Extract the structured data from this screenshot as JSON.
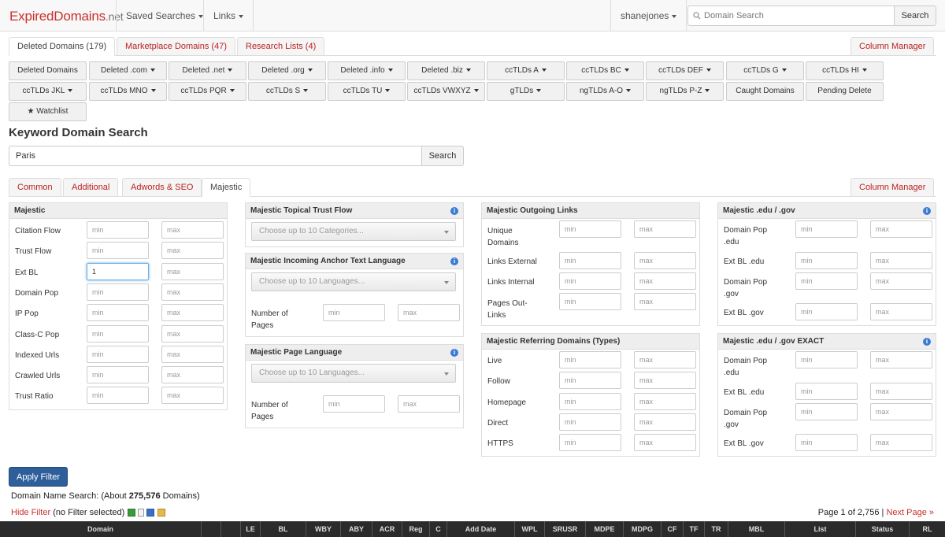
{
  "nav": {
    "brand_main": "ExpiredDomains",
    "brand_tld": ".net",
    "saved_searches": "Saved Searches",
    "links": "Links",
    "user": "shanejones",
    "search_placeholder": "Domain Search",
    "search_button": "Search"
  },
  "main_tabs": [
    {
      "label": "Deleted Domains (179)"
    },
    {
      "label": "Marketplace Domains (47)"
    },
    {
      "label": "Research Lists (4)"
    }
  ],
  "column_manager": "Column Manager",
  "filter_buttons_row1": [
    "Deleted Domains",
    "Deleted .com",
    "Deleted .net",
    "Deleted .org",
    "Deleted .info",
    "Deleted .biz",
    "ccTLDs A",
    "ccTLDs BC",
    "ccTLDs DEF",
    "ccTLDs G",
    "ccTLDs HI"
  ],
  "filter_buttons_row2": [
    "ccTLDs JKL",
    "ccTLDs MNO",
    "ccTLDs PQR",
    "ccTLDs S",
    "ccTLDs TU",
    "ccTLDs VWXYZ",
    "gTLDs",
    "ngTLDs A-O",
    "ngTLDs P-Z",
    "Caught Domains",
    "Pending Delete"
  ],
  "watchlist": "Watchlist",
  "keyword": {
    "title": "Keyword Domain Search",
    "value": "Paris",
    "button": "Search"
  },
  "filter_tabs": [
    {
      "label": "Common"
    },
    {
      "label": "Additional"
    },
    {
      "label": "Adwords & SEO"
    },
    {
      "label": "Majestic"
    }
  ],
  "placeholders": {
    "min": "min",
    "max": "max"
  },
  "majestic": {
    "title": "Majestic",
    "rows": [
      "Citation Flow",
      "Trust Flow",
      "Ext BL",
      "Domain Pop",
      "IP Pop",
      "Class-C Pop",
      "Indexed Urls",
      "Crawled Urls",
      "Trust Ratio"
    ],
    "ext_bl_min_value": "1"
  },
  "topical": {
    "title": "Majestic Topical Trust Flow",
    "placeholder": "Choose up to 10 Categories..."
  },
  "anchor": {
    "title": "Majestic Incoming Anchor Text Language",
    "placeholder": "Choose up to 10 Languages...",
    "pages_label_1": "Number of",
    "pages_label_2": "Pages"
  },
  "pagelang": {
    "title": "Majestic Page Language",
    "placeholder": "Choose up to 10 Languages...",
    "pages_label_1": "Number of",
    "pages_label_2": "Pages"
  },
  "outgoing": {
    "title": "Majestic Outgoing Links",
    "rows": [
      [
        "Unique",
        "Domains"
      ],
      [
        "Links External"
      ],
      [
        "Links Internal"
      ],
      [
        "Pages Out-",
        "Links"
      ]
    ]
  },
  "referring": {
    "title": "Majestic Referring Domains (Types)",
    "rows": [
      "Live",
      "Follow",
      "Homepage",
      "Direct",
      "HTTPS"
    ]
  },
  "edugov": {
    "title": "Majestic .edu / .gov",
    "rows": [
      [
        "Domain Pop",
        ".edu"
      ],
      [
        "Ext BL .edu"
      ],
      [
        "Domain Pop",
        ".gov"
      ],
      [
        "Ext BL .gov"
      ]
    ]
  },
  "edugov_exact": {
    "title": "Majestic .edu / .gov EXACT",
    "rows": [
      [
        "Domain Pop",
        ".edu"
      ],
      [
        "Ext BL .edu"
      ],
      [
        "Domain Pop",
        ".gov"
      ],
      [
        "Ext BL .gov"
      ]
    ]
  },
  "apply_filter": "Apply Filter",
  "results": {
    "prefix": "Domain Name Search: (About",
    "count": "275,576",
    "suffix": "Domains)",
    "hide_filter": "Hide Filter",
    "no_filter": "(no Filter selected)",
    "page_info": "Page 1 of 2,756 |",
    "next_page": "Next Page »"
  },
  "table_headers": [
    "Domain",
    "LE",
    "BL",
    "WBY",
    "ABY",
    "ACR",
    "Reg",
    "C",
    "Add Date",
    "WPL",
    "SRUSR",
    "MDPE",
    "MDPG",
    "CF",
    "TF",
    "TR",
    "MBL",
    "List",
    "Status",
    "RL"
  ]
}
